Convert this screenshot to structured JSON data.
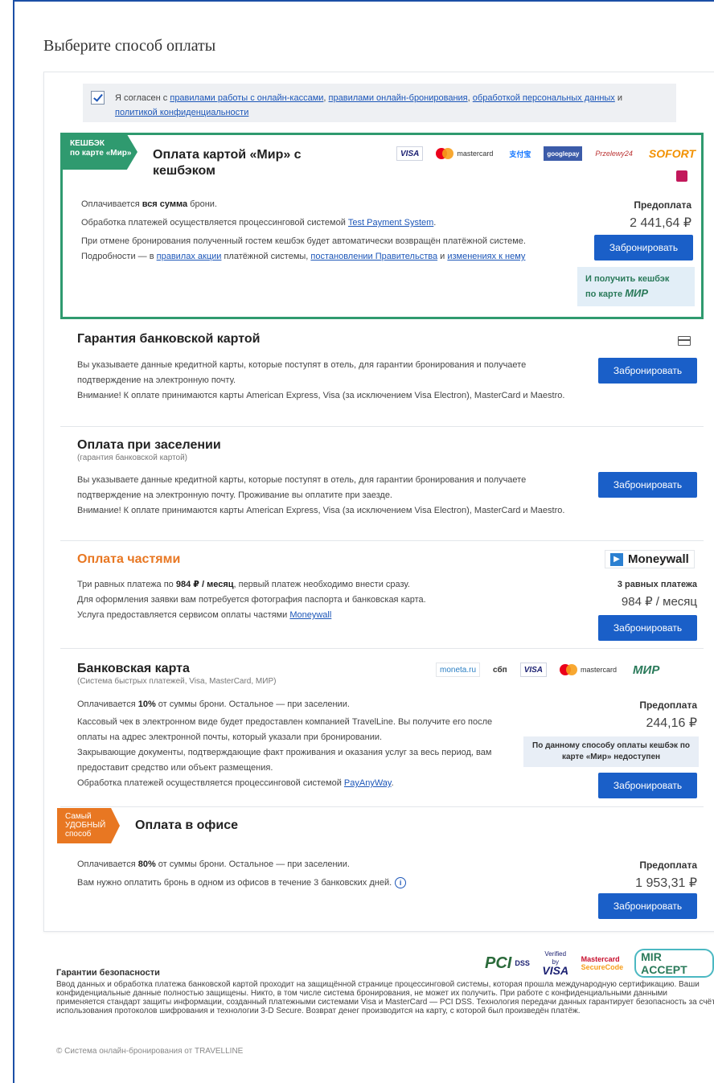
{
  "page_title": "Выберите способ оплаты",
  "agreement": {
    "prefix": "Я согласен с ",
    "link1": "правилами работы с онлайн-кассами",
    "sep1": ", ",
    "link2": "правилами онлайн-бронирования",
    "sep2": ", ",
    "link3": "обработкой персональных данных",
    "sep3": " и ",
    "link4": "политикой конфиденциальности"
  },
  "mir": {
    "tag_line1": "КЕШБЭК",
    "tag_line2": "по карте «Мир»",
    "title": "Оплата картой «Мир» с кешбэком",
    "logos": [
      "VISA",
      "mastercard",
      "支付宝",
      "googlepay",
      "Przelewy24",
      "SOFORT"
    ],
    "line1_prefix": "Оплачивается ",
    "line1_bold": "вся сумма",
    "line1_suffix": " брони.",
    "line2_prefix": "Обработка платежей осуществляется процессинговой системой ",
    "line2_link": "Test Payment System",
    "line2_suffix": ".",
    "line3_a": "При отмене бронирования полученный гостем кешбэк будет автоматически возвращён платёжной системе. Подробности — в ",
    "line3_link1": "правилах акции",
    "line3_b": " платёжной системы, ",
    "line3_link2": "постановлении Правительства",
    "line3_c": " и ",
    "line3_link3": "изменениях к нему",
    "prepay_label": "Предоплата",
    "price": "2 441,64 ₽",
    "button": "Забронировать",
    "cashback_line1": "И получить кешбэк",
    "cashback_line2": "по карте ",
    "cashback_mir": "МИР"
  },
  "guarantee": {
    "title": "Гарантия банковской картой",
    "text1": "Вы указываете данные кредитной карты, которые поступят в отель, для гарантии бронирования и получаете подтверждение на электронную почту.",
    "text2": "Внимание! К оплате принимаются карты American Express, Visa (за исключением Visa Electron), MasterCard и Maestro.",
    "button": "Забронировать"
  },
  "checkin": {
    "title": "Оплата при заселении",
    "subtitle": "(гарантия банковской картой)",
    "text1": "Вы указываете данные кредитной карты, которые поступят в отель, для гарантии бронирования и получаете подтверждение на электронную почту. Проживание вы оплатите при заезде.",
    "text2": "Внимание! К оплате принимаются карты American Express, Visa (за исключением Visa Electron), MasterCard и Maestro.",
    "button": "Забронировать"
  },
  "installments": {
    "title": "Оплата частями",
    "logo": "Moneywall",
    "line1_prefix": "Три равных платежа по ",
    "line1_bold": "984 ₽ / месяц",
    "line1_suffix": ", первый платеж необходимо внести сразу.",
    "line2": "Для оформления заявки вам потребуется фотография паспорта и банковская карта.",
    "line3_prefix": "Услуга предоставляется сервисом оплаты частями ",
    "line3_link": "Moneywall",
    "label": "3 равных платежа",
    "price": "984 ₽ / месяц",
    "button": "Забронировать"
  },
  "bank_card": {
    "title": "Банковская карта",
    "subtitle": "(Система быстрых платежей, Visa, MasterCard, МИР)",
    "logos": [
      "moneta.ru",
      "сбп",
      "VISA",
      "mastercard",
      "МИР"
    ],
    "line1_prefix": "Оплачивается ",
    "line1_bold": "10%",
    "line1_suffix": " от суммы брони. Остальное — при заселении.",
    "line2": "Кассовый чек в электронном виде будет предоставлен компанией TravelLine. Вы получите его после оплаты на адрес электронной почты, который указали при бронировании.",
    "line3": "Закрывающие документы, подтверждающие факт проживания и оказания услуг за весь период, вам предоставит средство или объект размещения.",
    "line4_prefix": "Обработка платежей осуществляется процессинговой системой ",
    "line4_link": "PayAnyWay",
    "line4_suffix": ".",
    "prepay_label": "Предоплата",
    "price": "244,16 ₽",
    "note": "По данному способу оплаты кешбэк по карте «Мир» недоступен",
    "button": "Забронировать"
  },
  "office": {
    "tag_line1": "Самый",
    "tag_line2": "УДОБНЫЙ",
    "tag_line3": "способ",
    "title": "Оплата в офисе",
    "line1_prefix": "Оплачивается ",
    "line1_bold": "80%",
    "line1_suffix": " от суммы брони. Остальное — при заселении.",
    "line2": "Вам нужно оплатить бронь в одном из офисов в течение 3 банковских дней.",
    "prepay_label": "Предоплата",
    "price": "1 953,31 ₽",
    "button": "Забронировать"
  },
  "security": {
    "title": "Гарантии безопасности",
    "text": "Ввод данных и обработка платежа банковской картой проходит на защищённой странице процессинговой системы, которая прошла международную сертификацию. Ваши конфиденциальные данные полностью защищены. Никто, в том числе система бронирования, не может их получить. При работе с конфиденциальными данными применяется стандарт защиты информации, созданный платежными системами Visa и MasterCard — PCI DSS. Технология передачи данных гарантирует безопасность за счёт использования протоколов шифрования и технологии 3-D Secure. Возврат денег производится на карту, с которой был произведён платёж.",
    "logo_pci": "PCI",
    "logo_dss": "DSS",
    "logo_vbv1": "Verified by",
    "logo_vbv2": "VISA",
    "logo_mc1": "Mastercard",
    "logo_mc2": "SecureCode",
    "logo_mir": "MIR ACCEPT"
  },
  "copyright": "© Система онлайн-бронирования от TRAVELLINE"
}
